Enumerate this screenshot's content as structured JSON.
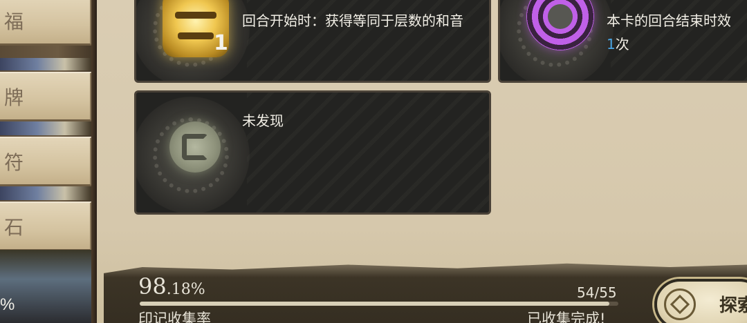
{
  "sidebar": {
    "tabs": [
      {
        "label": "福"
      },
      {
        "label": "牌"
      },
      {
        "label": "符"
      },
      {
        "label": "石"
      }
    ],
    "percent_fragment": "%"
  },
  "cards": [
    {
      "id": "card-1",
      "title": "回合开始时：获得等同于层数的和音",
      "count": "1",
      "icon": "gold-rune-icon"
    },
    {
      "id": "card-2",
      "title": "本卡的回合结束时效",
      "count_value": "1",
      "count_suffix": "次",
      "icon": "purple-rings-icon"
    },
    {
      "id": "card-3",
      "title": "未发现",
      "icon": "undiscovered-rune-icon"
    }
  ],
  "progress": {
    "percent_whole": "98",
    "percent_decimal": ".18%",
    "percent_value": 0.9818,
    "ratio": "54/55",
    "label": "印记收集率",
    "status": "已收集完成!"
  },
  "explore_button": {
    "label": "探索"
  },
  "colors": {
    "parchment": "#d9ccb2",
    "card_bg": "#232321",
    "accent_blue": "#4aa6e6",
    "text_light": "#f2efe6"
  }
}
